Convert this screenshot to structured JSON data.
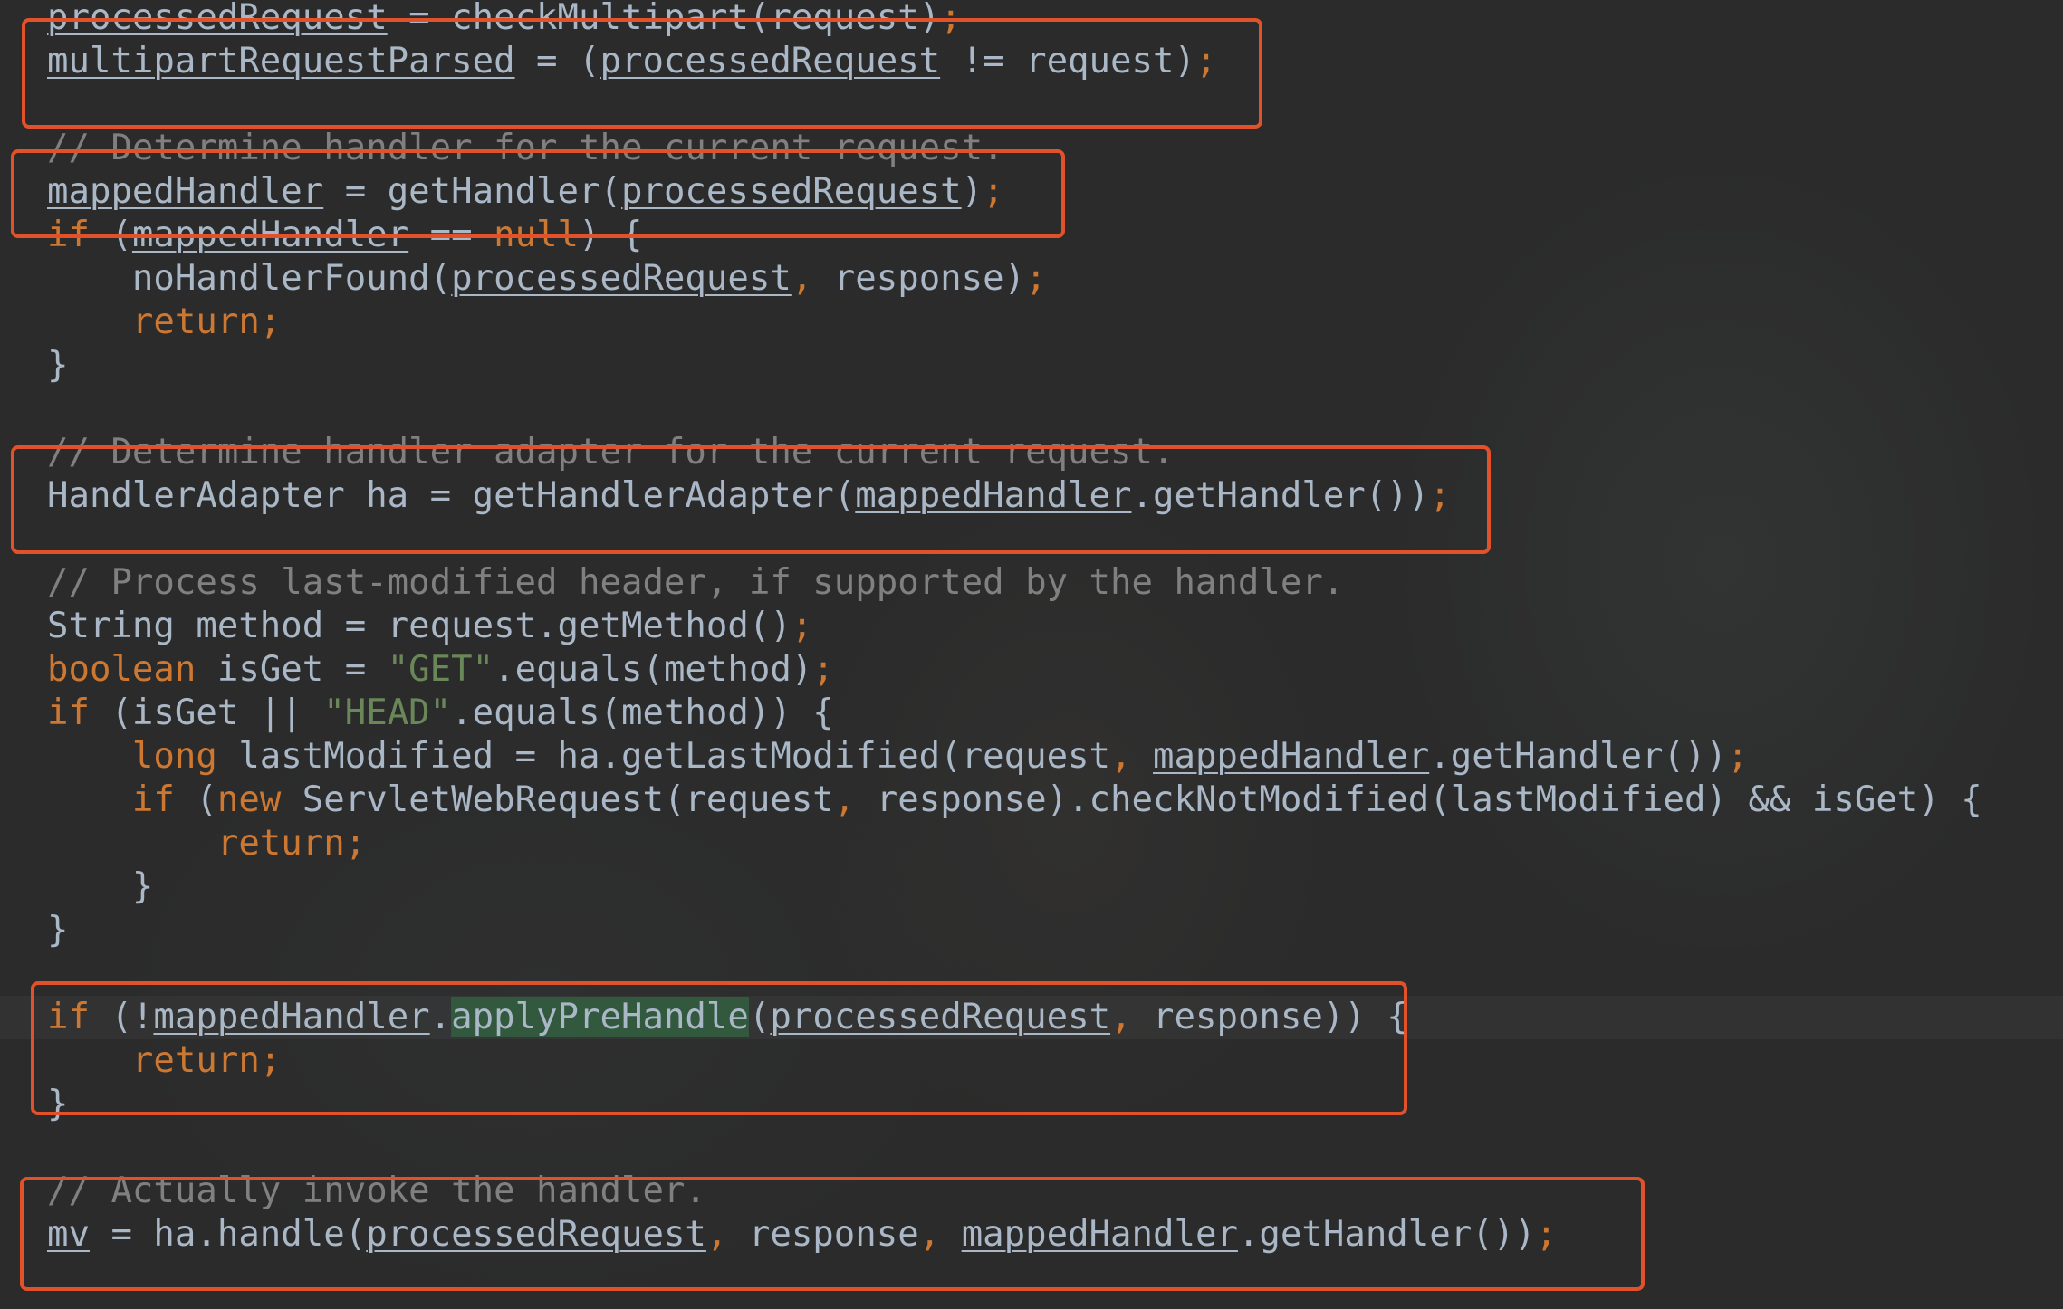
{
  "colors": {
    "background": "#2b2b2b",
    "text": "#a9b7c6",
    "keyword": "#cc7832",
    "string": "#6a8759",
    "comment": "#808080",
    "annotation_box": "#e2522a"
  },
  "lines": [
    [
      {
        "t": "processedRequest",
        "c": "var"
      },
      {
        "t": " = checkMultipart(request)"
      },
      {
        "t": ";",
        "c": "op"
      }
    ],
    [
      {
        "t": "multipartRequestParsed",
        "c": "var"
      },
      {
        "t": " = ("
      },
      {
        "t": "processedRequest",
        "c": "var"
      },
      {
        "t": " != request)"
      },
      {
        "t": ";",
        "c": "op"
      }
    ],
    [],
    [
      {
        "t": "// Determine handler for the current request.",
        "c": "cm"
      }
    ],
    [
      {
        "t": "mappedHandler",
        "c": "var"
      },
      {
        "t": " = getHandler("
      },
      {
        "t": "processedRequest",
        "c": "var"
      },
      {
        "t": ")"
      },
      {
        "t": ";",
        "c": "op"
      }
    ],
    [
      {
        "t": "if",
        "c": "kw"
      },
      {
        "t": " ("
      },
      {
        "t": "mappedHandler",
        "c": "var"
      },
      {
        "t": " == "
      },
      {
        "t": "null",
        "c": "kw"
      },
      {
        "t": ") {"
      }
    ],
    [
      {
        "t": "    noHandlerFound("
      },
      {
        "t": "processedRequest",
        "c": "var"
      },
      {
        "t": ",",
        "c": "op"
      },
      {
        "t": " response)"
      },
      {
        "t": ";",
        "c": "op"
      }
    ],
    [
      {
        "t": "    "
      },
      {
        "t": "return;",
        "c": "kw"
      }
    ],
    [
      {
        "t": "}"
      }
    ],
    [],
    [
      {
        "t": "// Determine handler adapter for the current request.",
        "c": "cm"
      }
    ],
    [
      {
        "t": "HandlerAdapter ha = getHandlerAdapter("
      },
      {
        "t": "mappedHandler",
        "c": "var"
      },
      {
        "t": ".getHandler())"
      },
      {
        "t": ";",
        "c": "op"
      }
    ],
    [],
    [
      {
        "t": "// Process last-modified header, if supported by the handler.",
        "c": "cm"
      }
    ],
    [
      {
        "t": "String method = request.getMethod()"
      },
      {
        "t": ";",
        "c": "op"
      }
    ],
    [
      {
        "t": "boolean",
        "c": "kw"
      },
      {
        "t": " isGet = "
      },
      {
        "t": "\"GET\"",
        "c": "str"
      },
      {
        "t": ".equals(method)"
      },
      {
        "t": ";",
        "c": "op"
      }
    ],
    [
      {
        "t": "if",
        "c": "kw"
      },
      {
        "t": " (isGet || "
      },
      {
        "t": "\"HEAD\"",
        "c": "str"
      },
      {
        "t": ".equals(method)) {"
      }
    ],
    [
      {
        "t": "    "
      },
      {
        "t": "long",
        "c": "kw"
      },
      {
        "t": " lastModified = ha.getLastModified(request"
      },
      {
        "t": ",",
        "c": "op"
      },
      {
        "t": " "
      },
      {
        "t": "mappedHandler",
        "c": "var"
      },
      {
        "t": ".getHandler())"
      },
      {
        "t": ";",
        "c": "op"
      }
    ],
    [
      {
        "t": "    "
      },
      {
        "t": "if",
        "c": "kw"
      },
      {
        "t": " ("
      },
      {
        "t": "new",
        "c": "kw"
      },
      {
        "t": " ServletWebRequest(request"
      },
      {
        "t": ",",
        "c": "op"
      },
      {
        "t": " response).checkNotModified(lastModified) && isGet) {"
      }
    ],
    [
      {
        "t": "        "
      },
      {
        "t": "return;",
        "c": "kw"
      }
    ],
    [
      {
        "t": "    }"
      }
    ],
    [
      {
        "t": "}"
      }
    ],
    [],
    [
      {
        "t": "if",
        "c": "kw"
      },
      {
        "t": " (!"
      },
      {
        "t": "mappedHandler",
        "c": "var"
      },
      {
        "t": "."
      },
      {
        "t": "applyPreHandle",
        "c": "hl"
      },
      {
        "t": "("
      },
      {
        "t": "processedRequest",
        "c": "var"
      },
      {
        "t": ",",
        "c": "op"
      },
      {
        "t": " response)) {"
      }
    ],
    [
      {
        "t": "    "
      },
      {
        "t": "return;",
        "c": "kw"
      }
    ],
    [
      {
        "t": "}"
      }
    ],
    [],
    [
      {
        "t": "// Actually invoke the handler.",
        "c": "cm"
      }
    ],
    [
      {
        "t": "mv",
        "c": "var"
      },
      {
        "t": " = ha.handle("
      },
      {
        "t": "processedRequest",
        "c": "var"
      },
      {
        "t": ",",
        "c": "op"
      },
      {
        "t": " response"
      },
      {
        "t": ",",
        "c": "op"
      },
      {
        "t": " "
      },
      {
        "t": "mappedHandler",
        "c": "var"
      },
      {
        "t": ".getHandler())"
      },
      {
        "t": ";",
        "c": "op"
      }
    ]
  ],
  "caret_line": 23
}
